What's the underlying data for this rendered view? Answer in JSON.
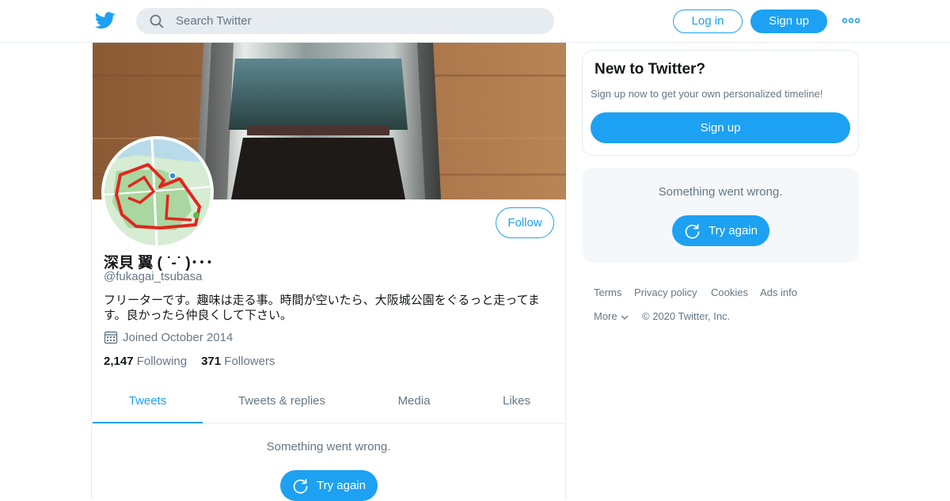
{
  "header": {
    "search_placeholder": "Search Twitter",
    "login_label": "Log in",
    "signup_label": "Sign up"
  },
  "profile": {
    "name": "深貝 翼 (   ˙-˙   )･･･",
    "handle": "@fukagai_tsubasa",
    "bio": "フリーターです。趣味は走る事。時間が空いたら、大阪城公園をぐるっと走ってます。良かったら仲良くして下さい。",
    "joined": "Joined October 2014",
    "following_count": "2,147",
    "following_label": "Following",
    "followers_count": "371",
    "followers_label": "Followers",
    "follow_label": "Follow"
  },
  "tabs": [
    "Tweets",
    "Tweets & replies",
    "Media",
    "Likes"
  ],
  "timeline": {
    "error_text": "Something went wrong.",
    "retry_label": "Try again"
  },
  "sidebar": {
    "new_title": "New to Twitter?",
    "new_subtitle": "Sign up now to get your own personalized timeline!",
    "signup_label": "Sign up",
    "error_text": "Something went wrong.",
    "retry_label": "Try again"
  },
  "footer": {
    "links": [
      "Terms",
      "Privacy policy",
      "Cookies",
      "Ads info"
    ],
    "more_label": "More",
    "copyright": "© 2020 Twitter, Inc."
  },
  "colors": {
    "accent": "#1da1f2",
    "muted_text": "#657786",
    "border": "#e6ecf0"
  }
}
